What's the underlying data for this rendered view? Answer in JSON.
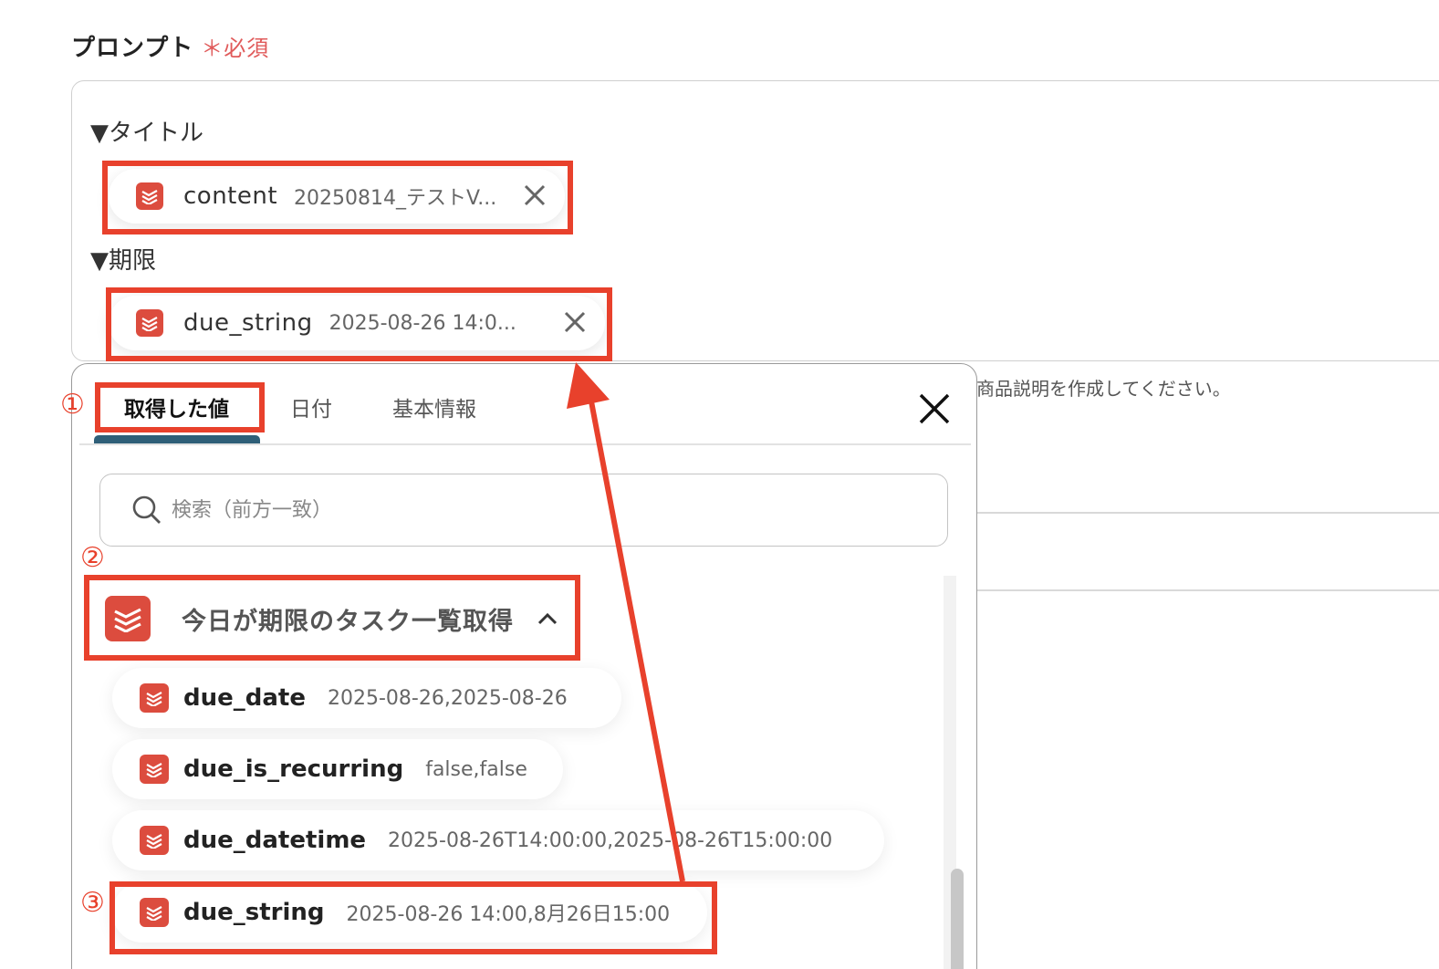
{
  "field": {
    "label": "プロンプト",
    "required_mark": "＊",
    "required_text": "必須"
  },
  "prompt": {
    "sections": [
      {
        "title": "▼タイトル",
        "token": {
          "key": "content",
          "value": "20250814_テストV..."
        }
      },
      {
        "title": "▼期限",
        "token": {
          "key": "due_string",
          "value": "2025-08-26 14:0..."
        }
      }
    ]
  },
  "background_hint": "商品説明を作成してください。",
  "popover": {
    "tabs": [
      {
        "label": "取得した値",
        "active": true
      },
      {
        "label": "日付",
        "active": false
      },
      {
        "label": "基本情報",
        "active": false
      }
    ],
    "search_placeholder": "検索（前方一致）",
    "group": {
      "name": "今日が期限のタスク一覧取得",
      "items": [
        {
          "key": "due_date",
          "value": "2025-08-26,2025-08-26"
        },
        {
          "key": "due_is_recurring",
          "value": "false,false"
        },
        {
          "key": "due_datetime",
          "value": "2025-08-26T14:00:00,2025-08-26T15:00:00"
        },
        {
          "key": "due_string",
          "value": "2025-08-26 14:00,8月26日15:00"
        }
      ]
    }
  },
  "annotations": {
    "step1": "①",
    "step2": "②",
    "step3": "③"
  },
  "colors": {
    "accent_red": "#e8412c",
    "todoist_red": "#dc4c3e",
    "tab_indicator": "#2f5f78"
  }
}
